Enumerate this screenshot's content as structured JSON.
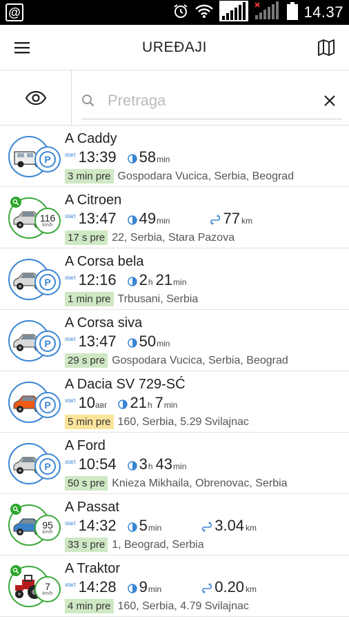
{
  "status_bar": {
    "time": "14.37",
    "at_symbol": "@"
  },
  "header": {
    "title": "UREĐAJI"
  },
  "search": {
    "placeholder": "Pretraga"
  },
  "vehicles": [
    {
      "name": "A Caddy",
      "start_label": "start",
      "time": "13:39",
      "time_suffix": "",
      "dur_a": "58",
      "dur_a_unit": "min",
      "dur_b": "",
      "dur_b_unit": "",
      "distance": "",
      "distance_unit": "",
      "ago": "3 min pre",
      "address": "Gospodara Vucica, Serbia, Beograd",
      "moving": false,
      "speed": "",
      "speed_unit": "",
      "ago_color": "green"
    },
    {
      "name": "A Citroen",
      "start_label": "start",
      "time": "13:47",
      "time_suffix": "",
      "dur_a": "49",
      "dur_a_unit": "min",
      "dur_b": "",
      "dur_b_unit": "",
      "distance": "77",
      "distance_unit": "km",
      "ago": "17 s pre",
      "address": "22, Serbia, Stara Pazova",
      "moving": true,
      "speed": "116",
      "speed_unit": "km/h",
      "ago_color": "green"
    },
    {
      "name": "A Corsa bela",
      "start_label": "start",
      "time": "12:16",
      "time_suffix": "",
      "dur_a": "2",
      "dur_a_unit": "h",
      "dur_b": "21",
      "dur_b_unit": "min",
      "distance": "",
      "distance_unit": "",
      "ago": "1 min pre",
      "address": "Trbusani, Serbia",
      "moving": false,
      "speed": "",
      "speed_unit": "",
      "ago_color": "green"
    },
    {
      "name": "A Corsa siva",
      "start_label": "start",
      "time": "13:47",
      "time_suffix": "",
      "dur_a": "50",
      "dur_a_unit": "min",
      "dur_b": "",
      "dur_b_unit": "",
      "distance": "",
      "distance_unit": "",
      "ago": "29 s pre",
      "address": "Gospodara Vucica, Serbia, Beograd",
      "moving": false,
      "speed": "",
      "speed_unit": "",
      "ago_color": "green"
    },
    {
      "name": "A Dacia SV 729-SĆ",
      "start_label": "start",
      "time": "10",
      "time_suffix": "авг",
      "dur_a": "21",
      "dur_a_unit": "h",
      "dur_b": "7",
      "dur_b_unit": "min",
      "distance": "",
      "distance_unit": "",
      "ago": "5 min pre",
      "address": "160, Serbia, 5.29  Svilajnac",
      "moving": false,
      "speed": "",
      "speed_unit": "",
      "ago_color": "yellow"
    },
    {
      "name": "A Ford",
      "start_label": "start",
      "time": "10:54",
      "time_suffix": "",
      "dur_a": "3",
      "dur_a_unit": "h",
      "dur_b": "43",
      "dur_b_unit": "min",
      "distance": "",
      "distance_unit": "",
      "ago": "50 s pre",
      "address": "Knieza Mikhaila, Obrenovac, Serbia",
      "moving": false,
      "speed": "",
      "speed_unit": "",
      "ago_color": "green"
    },
    {
      "name": "A Passat",
      "start_label": "start",
      "time": "14:32",
      "time_suffix": "",
      "dur_a": "5",
      "dur_a_unit": "min",
      "dur_b": "",
      "dur_b_unit": "",
      "distance": "3.04",
      "distance_unit": "km",
      "ago": "33 s pre",
      "address": "1, Beograd, Serbia",
      "moving": true,
      "speed": "95",
      "speed_unit": "km/h",
      "ago_color": "green"
    },
    {
      "name": "A Traktor",
      "start_label": "start",
      "time": "14:28",
      "time_suffix": "",
      "dur_a": "9",
      "dur_a_unit": "min",
      "dur_b": "",
      "dur_b_unit": "",
      "distance": "0.20",
      "distance_unit": "km",
      "ago": "4 min pre",
      "address": "160, Serbia, 4.79  Svilajnac",
      "moving": true,
      "speed": "7",
      "speed_unit": "km/h",
      "ago_color": "green"
    }
  ],
  "colors": {
    "parked": "#3a86d4",
    "moving": "#3aa83a",
    "ago_green": "#cfe8c4",
    "ago_yellow": "#fbe49a"
  },
  "icons": {
    "menu": "hamburger-icon",
    "map": "map-icon",
    "eye": "eye-icon",
    "search": "search-icon",
    "clear": "close-icon",
    "parked": "parking-icon",
    "duration": "half-circle-clock-icon",
    "distance": "route-icon"
  },
  "vehicle_types": [
    "van",
    "car",
    "car",
    "car",
    "car-orange",
    "car",
    "car-blue",
    "tractor"
  ]
}
